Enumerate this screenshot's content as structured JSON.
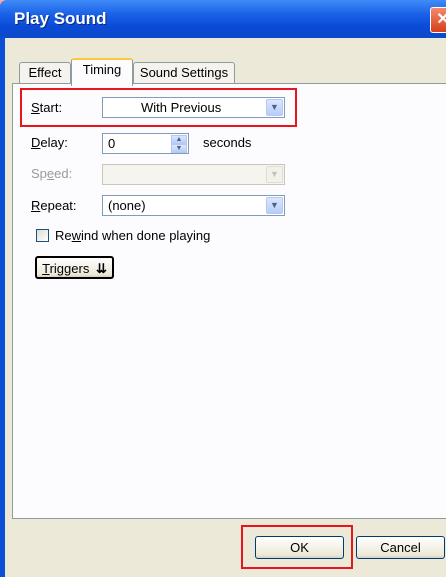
{
  "dialog": {
    "title": "Play Sound",
    "close_glyph": "✕"
  },
  "tabs": [
    {
      "label": "Effect",
      "active": false
    },
    {
      "label": "Timing",
      "active": true
    },
    {
      "label": "Sound Settings",
      "active": false
    }
  ],
  "timing": {
    "start": {
      "label_key": "S",
      "label_rest": "tart:",
      "value": "With Previous"
    },
    "delay": {
      "label_key": "D",
      "label_rest": "elay:",
      "value": "0",
      "unit": "seconds"
    },
    "speed": {
      "label_pre": "Sp",
      "label_key": "e",
      "label_rest": "ed:",
      "value": "",
      "enabled": false
    },
    "repeat": {
      "label_key": "R",
      "label_rest": "epeat:",
      "value": "(none)"
    },
    "rewind": {
      "label_pre": "Re",
      "label_key": "w",
      "label_rest": "ind when done playing",
      "checked": false
    },
    "triggers": {
      "label_key": "T",
      "label_rest": "riggers",
      "icon": "double-chevron-down-icon",
      "glyph": "¥"
    }
  },
  "buttons": {
    "ok": "OK",
    "cancel": "Cancel"
  },
  "icons": {
    "dropdown_arrow": "▼",
    "spin_up": "▲",
    "spin_down": "▼"
  },
  "colors": {
    "titlebar": "#0a4ad6",
    "highlight": "#e8141e",
    "background": "#f2a4a0"
  }
}
